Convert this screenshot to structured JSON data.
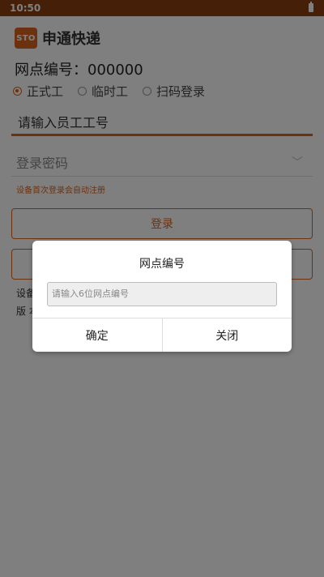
{
  "status_bar": {
    "time": "10:50"
  },
  "header": {
    "logo_text": "STO",
    "app_name": "申通快递"
  },
  "site": {
    "label": "网点编号：",
    "value": "000000"
  },
  "login_types": [
    {
      "label": "正式工",
      "selected": true
    },
    {
      "label": "临时工",
      "selected": false
    },
    {
      "label": "扫码登录",
      "selected": false
    }
  ],
  "form": {
    "employee_placeholder": "请输入员工工号",
    "password_placeholder": "登录密码",
    "hint": "设备首次登录会自动注册",
    "login_button": "登录"
  },
  "info": {
    "device_partial": "设备",
    "version_partial": "版 本"
  },
  "dialog": {
    "title": "网点编号",
    "input_placeholder": "请输入6位网点编号",
    "confirm": "确定",
    "close": "关闭"
  },
  "colors": {
    "accent": "#d9641e",
    "status_bar": "#8a3f10"
  }
}
